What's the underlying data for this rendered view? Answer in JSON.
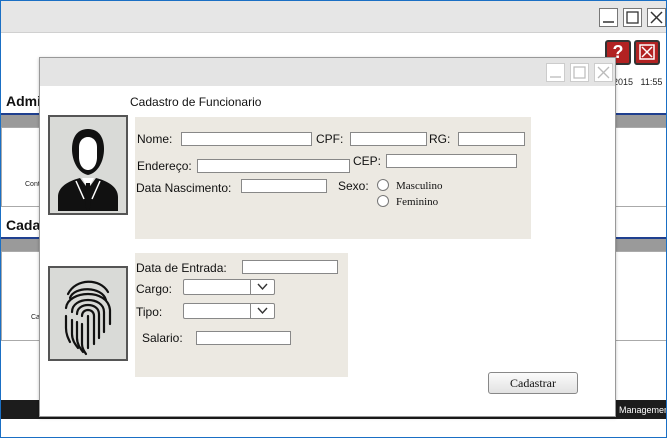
{
  "background_window": {
    "datetime": "2015   11:55",
    "heading_1": "Admi",
    "heading_2": "Cada",
    "small_label_1": "Cont",
    "small_label_2": "Ca",
    "footer_text": "Managemen",
    "help_label": "?"
  },
  "dialog": {
    "title": "Cadastro de Funcionario",
    "personal": {
      "nome_label": "Nome:",
      "nome_value": "",
      "cpf_label": "CPF:",
      "cpf_value": "",
      "rg_label": "RG:",
      "rg_value": "",
      "endereco_label": "Endereço:",
      "endereco_value": "",
      "cep_label": "CEP:",
      "cep_value": "",
      "nascimento_label": "Data Nascimento:",
      "nascimento_value": "",
      "sexo_label": "Sexo:",
      "sexo_options": [
        "Masculino",
        "Feminino"
      ]
    },
    "job": {
      "entrada_label": "Data de Entrada:",
      "entrada_value": "",
      "cargo_label": "Cargo:",
      "cargo_value": "",
      "tipo_label": "Tipo:",
      "tipo_value": "",
      "salario_label": "Salario:",
      "salario_value": ""
    },
    "submit_label": "Cadastrar"
  },
  "icons": [
    "minimize-icon",
    "maximize-icon",
    "close-icon",
    "help-icon",
    "user-silhouette-icon",
    "fingerprint-icon",
    "chevron-down-icon"
  ]
}
